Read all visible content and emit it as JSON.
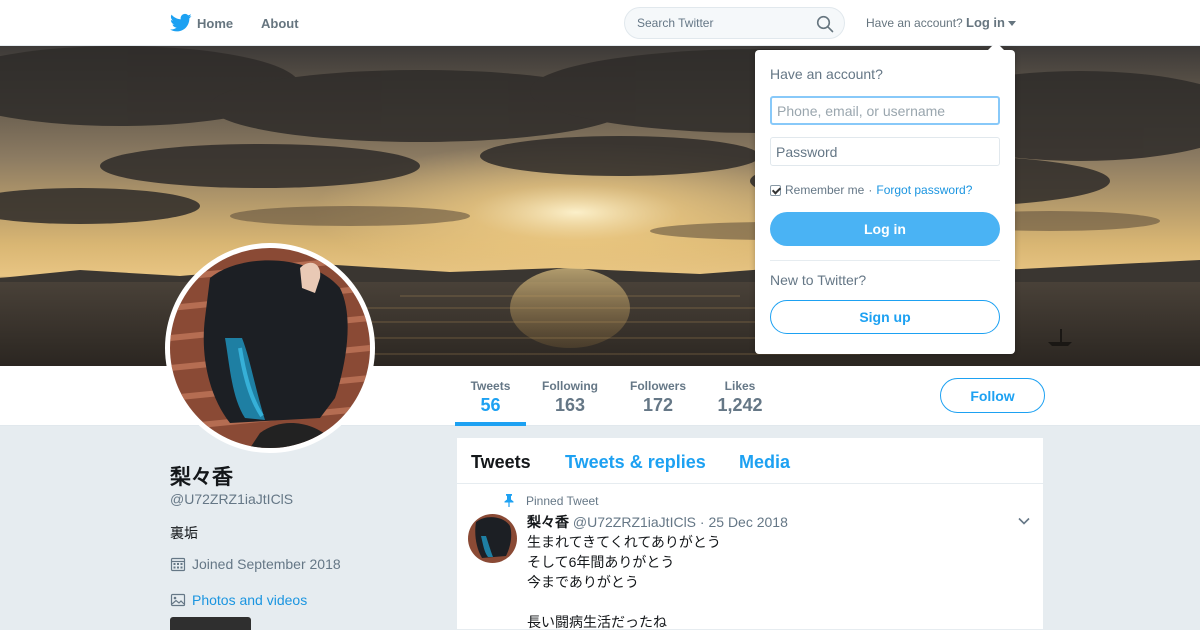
{
  "nav": {
    "home_label": "Home",
    "about_label": "About",
    "search_placeholder": "Search Twitter",
    "login_prompt": "Have an account?",
    "login_label": "Log in"
  },
  "profile": {
    "name": "梨々香",
    "handle": "@U72ZRZ1iaJtIClS",
    "bio": "裏垢",
    "joined": "Joined September 2018",
    "photos_label": "Photos and videos",
    "follow_label": "Follow"
  },
  "stats": [
    {
      "label": "Tweets",
      "value": "56"
    },
    {
      "label": "Following",
      "value": "163"
    },
    {
      "label": "Followers",
      "value": "172"
    },
    {
      "label": "Likes",
      "value": "1,242"
    }
  ],
  "tabs": [
    "Tweets",
    "Tweets & replies",
    "Media"
  ],
  "tweet": {
    "pinned_label": "Pinned Tweet",
    "name": "梨々香",
    "handle": "@U72ZRZ1iaJtIClS",
    "separator": "·",
    "date": "25 Dec 2018",
    "lines": [
      "生まれてきてくれてありがとう",
      "そして6年間ありがとう",
      "今までありがとう",
      "長い闘病生活だったね"
    ]
  },
  "login_dropdown": {
    "title": "Have an account?",
    "username_placeholder": "Phone, email, or username",
    "password_placeholder": "Password",
    "remember_label": "Remember me",
    "separator": "·",
    "forgot_label": "Forgot password?",
    "login_button": "Log in",
    "new_label": "New to Twitter?",
    "signup_button": "Sign up"
  },
  "colors": {
    "accent": "#1da1f2",
    "login_button": "#4ab3f4",
    "text_secondary": "#657786"
  }
}
